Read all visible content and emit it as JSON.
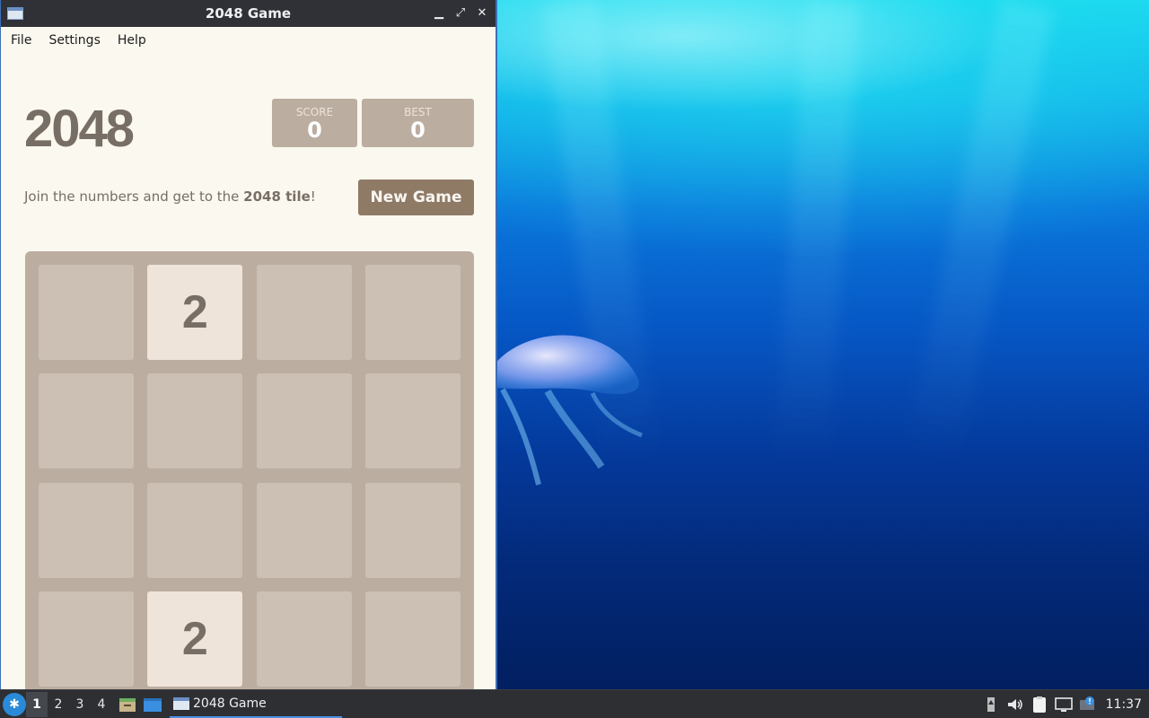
{
  "window": {
    "title": "2048 Game",
    "controls": [
      "minimize",
      "maximize",
      "close"
    ]
  },
  "menubar": {
    "items": [
      "File",
      "Settings",
      "Help"
    ]
  },
  "game": {
    "logo": "2048",
    "score": {
      "label": "SCORE",
      "value": "0"
    },
    "best": {
      "label": "BEST",
      "value": "0"
    },
    "intro_prefix": "Join the numbers and get to the ",
    "intro_bold": "2048 tile",
    "intro_suffix": "!",
    "new_game_label": "New Game",
    "board": [
      [
        "",
        "2",
        "",
        ""
      ],
      [
        "",
        "",
        "",
        ""
      ],
      [
        "",
        "",
        "",
        ""
      ],
      [
        "",
        "2",
        "",
        ""
      ]
    ]
  },
  "taskbar": {
    "workspaces": [
      "1",
      "2",
      "3",
      "4"
    ],
    "active_workspace": "1",
    "task_label": "2048 Game",
    "clock": "11:37",
    "tray_icons": [
      "battery-icon",
      "volume-icon",
      "clipboard-icon",
      "network-icon",
      "notification-icon"
    ]
  },
  "colors": {
    "board": "#bbada0",
    "tile_2": "#eee4da",
    "text": "#776e65",
    "button": "#8f7a66",
    "background": "#fbf8ef"
  }
}
